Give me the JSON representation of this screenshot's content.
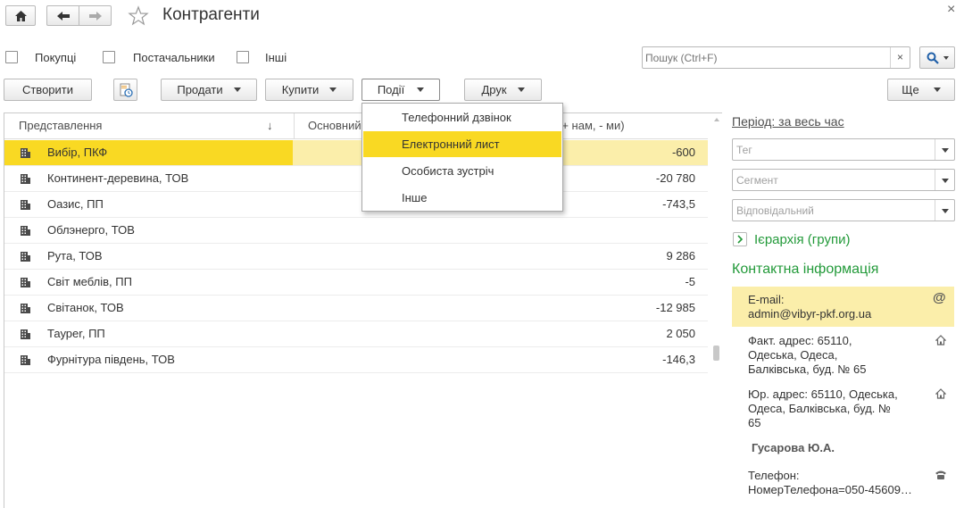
{
  "window": {
    "title": "Контрагенти",
    "close_glyph": "×"
  },
  "nav": {
    "home_icon": "home-icon",
    "back_icon": "arrow-left-icon",
    "forward_icon": "arrow-right-icon",
    "favorite_icon": "star-icon"
  },
  "filters": {
    "buyers_label": "Покупці",
    "suppliers_label": "Постачальники",
    "others_label": "Інші"
  },
  "search": {
    "placeholder": "Пошук (Ctrl+F)",
    "clear_glyph": "×"
  },
  "toolbar": {
    "create_label": "Створити",
    "sell_label": "Продати",
    "buy_label": "Купити",
    "events_label": "Події",
    "print_label": "Друк",
    "more_label": "Ще"
  },
  "events_menu": {
    "items": [
      {
        "label": "Телефонний дзвінок"
      },
      {
        "label": "Електронний лист"
      },
      {
        "label": "Особиста зустріч"
      },
      {
        "label": "Інше"
      }
    ],
    "highlighted_index": 1
  },
  "table": {
    "columns": {
      "name": "Представлення",
      "sort_glyph": "↓",
      "main_partial": "Основний",
      "debt_partial": "(+ нам, - ми)"
    },
    "rows": [
      {
        "name": "Вибір, ПКФ",
        "value": "-600"
      },
      {
        "name": "Континент-деревина, ТОВ",
        "value": "-20 780"
      },
      {
        "name": "Оазис, ПП",
        "value": "-743,5"
      },
      {
        "name": "Облэнерго, ТОВ",
        "value": ""
      },
      {
        "name": "Рута, ТОВ",
        "value": "9 286"
      },
      {
        "name": "Світ меблів, ПП",
        "value": "-5"
      },
      {
        "name": "Світанок, ТОВ",
        "value": "-12 985"
      },
      {
        "name": "Тауреr, ПП",
        "value": "2 050"
      },
      {
        "name": "Фурнітура південь, ТОВ",
        "value": "-146,3"
      }
    ],
    "selected_index": 0
  },
  "side": {
    "period_label": "Період: за весь час",
    "tag_placeholder": "Тег",
    "segment_placeholder": "Сегмент",
    "responsible_placeholder": "Відповідальний",
    "hierarchy_label": "Ієрархія (групи)",
    "contact_header": "Контактна інформація",
    "email_label": "E-mail:",
    "email_value": "admin@vibyr-pkf.org.ua",
    "email_glyph": "@",
    "fact_address": "Факт. адрес: 65110, Одеська, Одеса, Балківська, буд. № 65",
    "legal_address": "Юр. адрес: 65110, Одеська, Одеса, Балківська, буд. № 65",
    "contact_person": "Гусарова Ю.А.",
    "phone_label": "Телефон:",
    "phone_value": "НомерТелефона=050-45609…"
  },
  "colors": {
    "accent_yellow": "#f9d923",
    "selected_row": "#fbeeaa",
    "link_green": "#239a3a"
  }
}
